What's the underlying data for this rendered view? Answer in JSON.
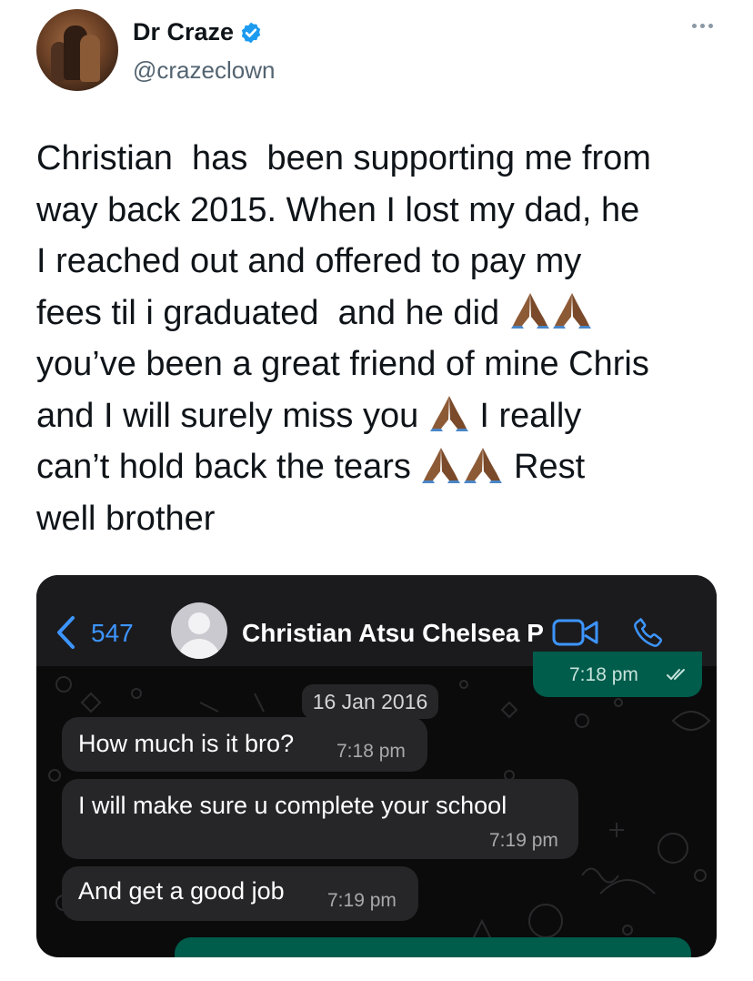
{
  "author": {
    "display_name": "Dr Craze",
    "handle": "@crazeclown",
    "verified": true,
    "avatar_icon": "profile-photo"
  },
  "tweet": {
    "lines": [
      "Christian  has  been supporting me from",
      "way back 2015. When I lost my dad, he",
      "I reached out and offered to pay my",
      "fees til i graduated  and he did ",
      "you’ve been a great friend of mine Chris",
      "and I will surely miss you ",
      " I really",
      "can’t hold back the tears ",
      " Rest",
      "well brother"
    ],
    "emoji": "🙏🏾"
  },
  "chat": {
    "back_count": "547",
    "contact_name": "Christian Atsu Chelsea P",
    "date_chip": "16 Jan 2016",
    "top_out_time": "7:18 pm",
    "messages": [
      {
        "text": "How much is it bro?",
        "time": "7:18 pm"
      },
      {
        "text": "I will make sure u complete your school",
        "time": "7:19 pm"
      },
      {
        "text": "And get a good job",
        "time": "7:19 pm"
      }
    ],
    "colors": {
      "accent": "#3d95ff",
      "incoming_bubble": "#262628",
      "outgoing_bubble": "#005c4b",
      "verified": "#1d9bf0"
    }
  }
}
